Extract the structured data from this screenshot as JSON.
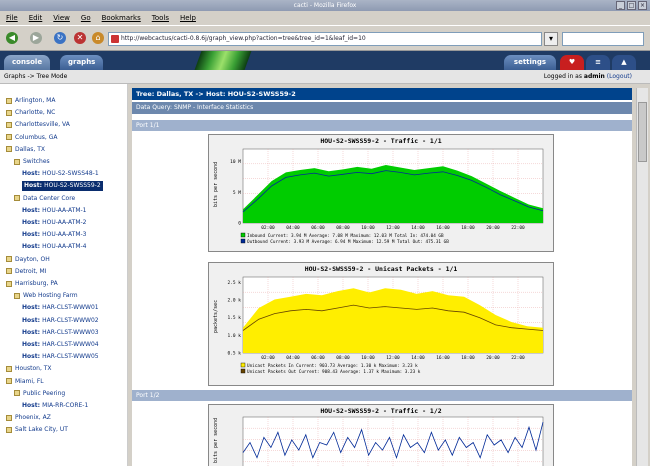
{
  "window": {
    "title": "cacti - Mozilla Firefox"
  },
  "menu": [
    "File",
    "Edit",
    "View",
    "Go",
    "Bookmarks",
    "Tools",
    "Help"
  ],
  "url": "http://webcactus/cacti-0.8.6j/graph_view.php?action=tree&tree_id=1&leaf_id=10",
  "tabs": {
    "console": "console",
    "graphs": "graphs",
    "settings": "settings"
  },
  "subbar": {
    "breadcrumb": "Graphs -> Tree Mode",
    "login_prefix": "Logged in as ",
    "user": "admin",
    "logout": "(Logout)"
  },
  "tree": [
    {
      "label": "Arlington, MA",
      "indent": 0
    },
    {
      "label": "Charlotte, NC",
      "indent": 0
    },
    {
      "label": "Charlottesville, VA",
      "indent": 0
    },
    {
      "label": "Columbus, GA",
      "indent": 0
    },
    {
      "label": "Dallas, TX",
      "indent": 0
    },
    {
      "label": "Switches",
      "indent": 1
    },
    {
      "label": "HOU-S2-SWSS48-1",
      "indent": 2,
      "host": true
    },
    {
      "label": "HOU-S2-SWSS59-2",
      "indent": 2,
      "host": true,
      "selected": true
    },
    {
      "label": "Data Center Core",
      "indent": 1
    },
    {
      "label": "HOU-AA-ATM-1",
      "indent": 2,
      "host": true
    },
    {
      "label": "HOU-AA-ATM-2",
      "indent": 2,
      "host": true
    },
    {
      "label": "HOU-AA-ATM-3",
      "indent": 2,
      "host": true
    },
    {
      "label": "HOU-AA-ATM-4",
      "indent": 2,
      "host": true
    },
    {
      "label": "Dayton, OH",
      "indent": 0
    },
    {
      "label": "Detroit, MI",
      "indent": 0
    },
    {
      "label": "Harrisburg, PA",
      "indent": 0
    },
    {
      "label": "Web Hosting Farm",
      "indent": 1
    },
    {
      "label": "HAR-CLST-WWW01",
      "indent": 2,
      "host": true
    },
    {
      "label": "HAR-CLST-WWW02",
      "indent": 2,
      "host": true
    },
    {
      "label": "HAR-CLST-WWW03",
      "indent": 2,
      "host": true
    },
    {
      "label": "HAR-CLST-WWW04",
      "indent": 2,
      "host": true
    },
    {
      "label": "HAR-CLST-WWW05",
      "indent": 2,
      "host": true
    },
    {
      "label": "Houston, TX",
      "indent": 0
    },
    {
      "label": "Miami, FL",
      "indent": 0
    },
    {
      "label": "Public Peering",
      "indent": 1
    },
    {
      "label": "MIA-RR-CORE-1",
      "indent": 2,
      "host": true
    },
    {
      "label": "Phoenix, AZ",
      "indent": 0
    },
    {
      "label": "Salt Lake City, UT",
      "indent": 0
    }
  ],
  "host_prefix": "Host:",
  "content": {
    "header": "Tree: Dallas, TX -> Host: HOU-S2-SWSS59-2",
    "query": "Data Query: SNMP - Interface Statistics",
    "port1": "Port 1/1",
    "port2": "Port 1/2"
  },
  "chart_data": [
    {
      "type": "area",
      "title": "HOU-S2-SWSS59-2 - Traffic - 1/1",
      "ylabel": "bits per second",
      "x": [
        "02:00",
        "04:00",
        "06:00",
        "08:00",
        "10:00",
        "12:00",
        "14:00",
        "16:00",
        "18:00",
        "20:00",
        "22:00"
      ],
      "yticks": [
        "0",
        "5 M",
        "10 M"
      ],
      "ylim": [
        0,
        12
      ],
      "series": [
        {
          "name": "Inbound",
          "color": "#00cc00",
          "values": [
            2.2,
            4.5,
            6.8,
            8.2,
            8.6,
            8.9,
            8.4,
            8.7,
            9.1,
            8.8,
            9.4,
            9.0,
            8.6,
            8.9,
            9.2,
            8.5,
            7.6,
            6.4,
            5.2,
            4.1,
            3.0,
            2.4
          ]
        },
        {
          "name": "Outbound",
          "color": "#002a97",
          "values": [
            1.8,
            3.8,
            6.0,
            7.4,
            7.8,
            8.1,
            7.6,
            7.9,
            8.2,
            8.0,
            8.5,
            8.2,
            7.8,
            8.1,
            8.3,
            7.7,
            6.9,
            5.8,
            4.6,
            3.6,
            2.6,
            2.0
          ]
        }
      ],
      "legend_rows": [
        "Inbound    Current:    3.94 M  Average:    7.08 M  Maximum:   12.03 M  Total In:    474.04 GB",
        "Outbound   Current:    3.93 M  Average:    6.94 M  Maximum:   12.59 M  Total Out:   475.31 GB"
      ]
    },
    {
      "type": "area",
      "title": "HOU-S2-SWSS59-2 - Unicast Packets - 1/1",
      "ylabel": "packets/sec",
      "x": [
        "02:00",
        "04:00",
        "06:00",
        "08:00",
        "10:00",
        "12:00",
        "14:00",
        "16:00",
        "18:00",
        "20:00",
        "22:00"
      ],
      "yticks": [
        "0.5 k",
        "1.0 k",
        "1.5 k",
        "2.0 k",
        "2.5 k"
      ],
      "ylim": [
        0,
        2.7
      ],
      "series": [
        {
          "name": "Unicast Packets In",
          "color": "#ffee00",
          "values": [
            0.9,
            1.6,
            1.9,
            2.0,
            2.1,
            2.05,
            2.2,
            2.3,
            2.15,
            2.3,
            2.25,
            2.1,
            2.2,
            2.05,
            2.0,
            1.7,
            1.35,
            1.1,
            0.95,
            0.9
          ]
        },
        {
          "name": "Unicast Packets Out",
          "color": "#664400",
          "values": [
            0.8,
            1.2,
            1.4,
            1.5,
            1.55,
            1.5,
            1.6,
            1.7,
            1.6,
            1.65,
            1.6,
            1.55,
            1.6,
            1.5,
            1.45,
            1.25,
            1.0,
            0.9,
            0.85,
            0.8
          ]
        }
      ],
      "legend_rows": [
        "Unicast Packets In    Current:    903.73  Average:    1.30 k   Maximum:    3.23 k",
        "Unicast Packets Out   Current:    908.43  Average:    1.37 k   Maximum:    3.23 k"
      ]
    },
    {
      "type": "line",
      "title": "HOU-S2-SWSS59-2 - Traffic - 1/2",
      "ylabel": "bits per second",
      "series": [
        {
          "name": "",
          "color": "#002a97",
          "values": [
            0.4,
            0.6,
            0.3,
            0.7,
            0.5,
            0.8,
            0.35,
            0.65,
            0.45,
            0.75,
            0.3,
            0.6,
            0.55,
            0.8,
            0.4,
            0.7,
            0.5,
            0.85,
            0.35,
            0.6,
            0.45,
            0.7,
            0.3,
            0.75,
            0.5,
            0.6,
            0.4,
            0.8,
            0.45,
            0.65,
            0.35,
            0.7,
            0.5,
            0.6,
            0.3,
            0.75,
            0.55,
            0.65,
            0.4,
            0.7,
            0.5,
            0.9,
            0.45,
            1.0
          ]
        }
      ]
    }
  ]
}
